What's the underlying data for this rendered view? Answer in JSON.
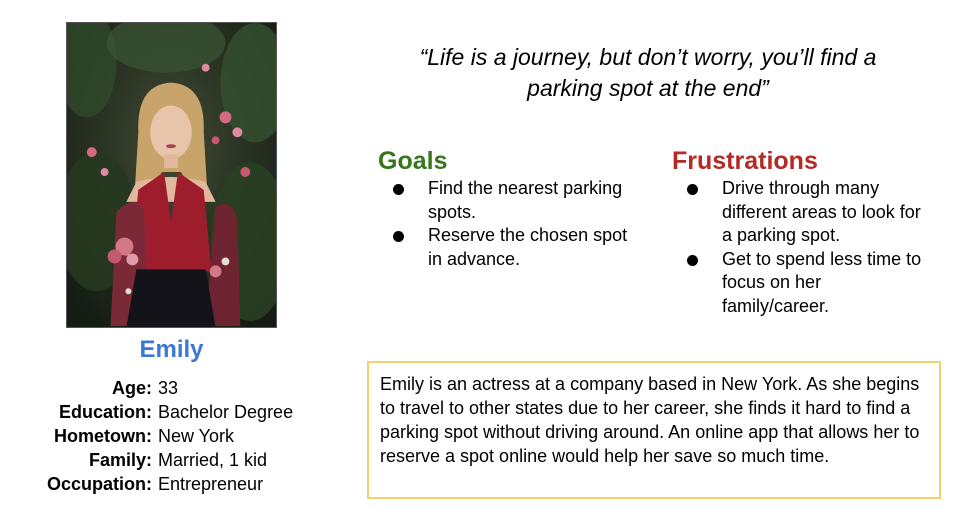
{
  "persona": {
    "name": "Emily",
    "photo_alt": "Portrait photo"
  },
  "details": [
    {
      "label": "Age:",
      "value": "33"
    },
    {
      "label": "Education:",
      "value": "Bachelor Degree"
    },
    {
      "label": "Hometown:",
      "value": "New York"
    },
    {
      "label": "Family:",
      "value": "Married, 1 kid"
    },
    {
      "label": "Occupation:",
      "value": "Entrepreneur"
    }
  ],
  "quote": {
    "line1": "“Life is a journey, but don’t worry, you’ll find a",
    "line2": "parking spot at the end”"
  },
  "goals": {
    "title": "Goals",
    "items": [
      "Find the nearest parking spots.",
      "Reserve the chosen spot in advance."
    ]
  },
  "frustrations": {
    "title": "Frustrations",
    "items": [
      "Drive through many different areas to look for a parking spot.",
      "Get to spend less time to focus on her family/career."
    ]
  },
  "bio": {
    "text": "Emily is an actress at a company based in New York. As she begins to travel to other states due to her career, she finds it hard to find a parking spot without driving around. An online app that allows her to reserve a spot online would help her save so much time."
  },
  "colors": {
    "name": "#3c78d8",
    "goals": "#38761d",
    "frustrations": "#b42a26",
    "bio_border": "#f1d36b"
  }
}
